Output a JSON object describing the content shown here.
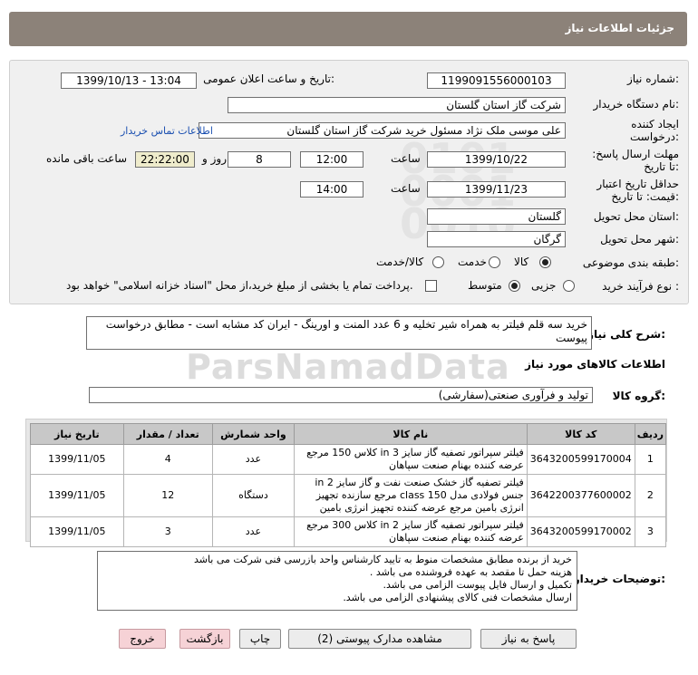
{
  "header": {
    "title": "جزئیات اطلاعات نیاز"
  },
  "fields": {
    "need_number_label": "شماره نیاز:",
    "need_number": "1199091556000103",
    "announce_label": "تاریخ و ساعت اعلان عمومی:",
    "announce_value": "1399/10/13 - 13:04",
    "buyer_label": "نام دستگاه خریدار:",
    "buyer_value": "شرکت گاز استان گلستان",
    "creator_label": "ایجاد کننده درخواست:",
    "creator_value": "علی موسی ملک نژاد مسئول خرید شرکت گاز استان گلستان",
    "contact_link": "اطلاعات تماس خریدار",
    "deadline_label": "مهلت ارسال پاسخ: تا تاریخ:",
    "deadline_date": "1399/10/22",
    "time_label": "ساعت",
    "deadline_time": "12:00",
    "days_value": "8",
    "days_label": "روز و",
    "remaining_value": "22:22:00",
    "remaining_label": "ساعت باقی مانده",
    "validity_label": "حداقل تاریخ اعتبار قیمت: تا تاریخ:",
    "validity_date": "1399/11/23",
    "validity_time": "14:00",
    "province_label": "استان محل تحویل:",
    "province_value": "گلستان",
    "city_label": "شهر محل تحویل:",
    "city_value": "گرگان",
    "category_label": "طبقه بندی موضوعی:",
    "category_options": [
      "کالا",
      "خدمت",
      "کالا/خدمت"
    ],
    "process_label": "نوع فرآیند خرید :",
    "process_options": [
      "جزیی",
      "متوسط"
    ],
    "payment_note": "پرداخت تمام یا بخشی از مبلغ خرید،از محل \"اسناد خزانه اسلامی\" خواهد بود."
  },
  "description": {
    "label": "شرح کلی نیاز:",
    "text": "خرید سه قلم فیلتر به همراه شیر تخلیه و 6 عدد المنت و اورینگ - ایران کد مشابه است - مطابق درخواست پیوست"
  },
  "goods": {
    "section_title": "اطلاعات کالاهای مورد نیاز",
    "group_label": "گروه کالا:",
    "group_value": "تولید و فرآوری صنعتی(سفارشی)",
    "columns": [
      "ردیف",
      "کد کالا",
      "نام کالا",
      "واحد شمارش",
      "تعداد / مقدار",
      "تاریخ نیاز"
    ],
    "rows": [
      {
        "idx": "1",
        "code": "3643200599170004",
        "name": "فیلتر سپراتور تصفیه گاز سایز in 3 کلاس 150 مرجع عرضه کننده بهنام صنعت سپاهان",
        "unit": "عدد",
        "qty": "4",
        "date": "1399/11/05"
      },
      {
        "idx": "2",
        "code": "3642200377600002",
        "name": "فیلتر تصفیه گاز خشک صنعت نفت و گاز سایز in 2 جنس فولادی مدل class 150 مرجع سازنده تجهیز انرژی بامین مرجع عرضه کننده تجهیز انرژی بامین",
        "unit": "دستگاه",
        "qty": "12",
        "date": "1399/11/05"
      },
      {
        "idx": "3",
        "code": "3643200599170002",
        "name": "فیلتر سپراتور تصفیه گاز سایز in 2 کلاس 300 مرجع عرضه کننده بهنام صنعت سپاهان",
        "unit": "عدد",
        "qty": "3",
        "date": "1399/11/05"
      }
    ]
  },
  "notes": {
    "label": "توضیحات خریدار:",
    "lines": [
      "خرید از برنده مطابق مشخصات منوط به تایید کارشناس واحد بازرسی فنی شرکت می باشد",
      "هزینه حمل تا مقصد به عهده فروشنده می باشد .",
      "تکمیل و ارسال فایل پیوست الزامی می باشد.",
      "ارسال مشخصات فنی کالای پیشنهادی الزامی می باشد."
    ]
  },
  "buttons": {
    "reply": "پاسخ به نیاز",
    "attachments": "مشاهده مدارک پیوستی (2)",
    "print": "چاپ",
    "back": "بازگشت",
    "exit": "خروج"
  },
  "watermark": {
    "brand": "ParsNamadData"
  }
}
